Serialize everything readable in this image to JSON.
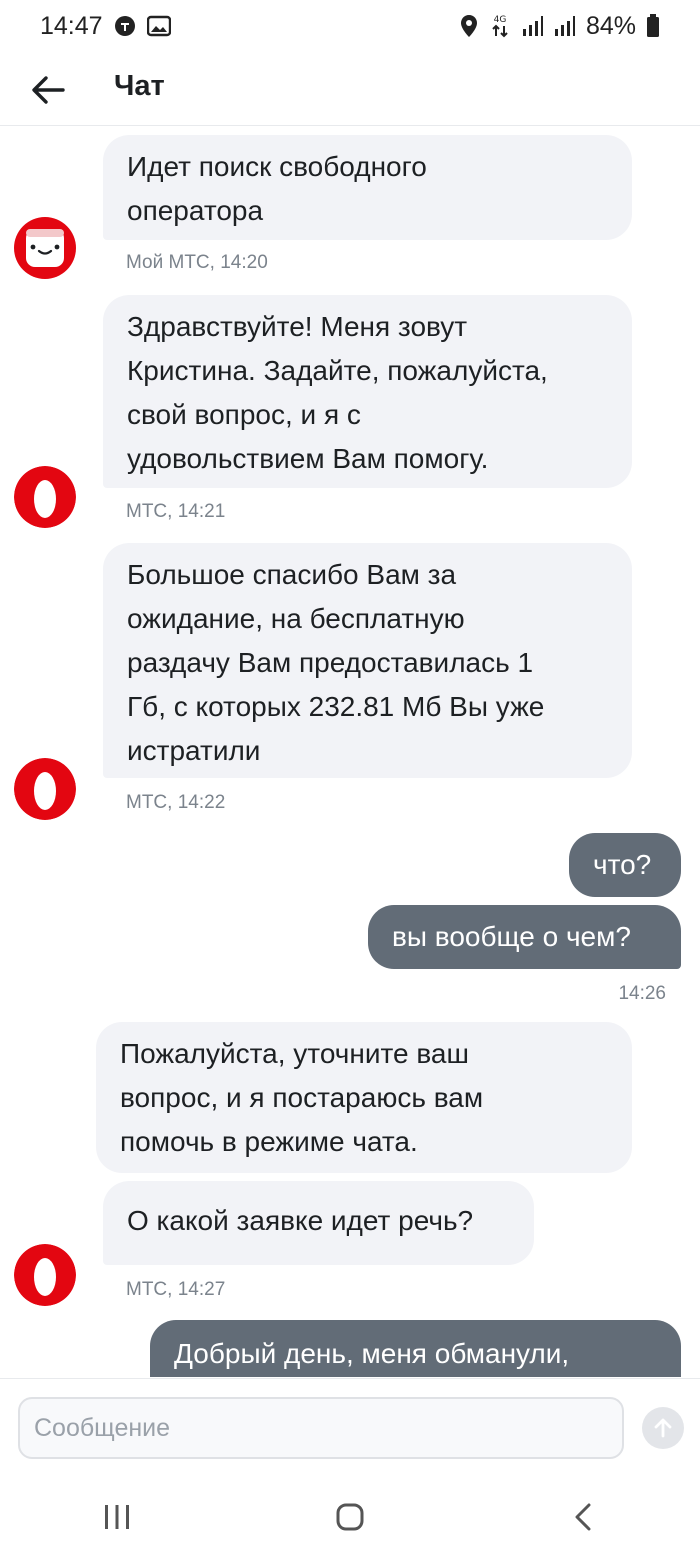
{
  "status_bar": {
    "time": "14:47",
    "network": "4G",
    "battery": "84%"
  },
  "app_bar": {
    "title": "Чат"
  },
  "messages": [
    {
      "id": "m1",
      "direction": "in",
      "text": "Идет поиск свободного\nоператора",
      "meta": "Мой МТС, 14:20",
      "avatar": "my-mts-bot"
    },
    {
      "id": "m2",
      "direction": "in",
      "text": "Здравствуйте! Меня зовут\nКристина. Задайте, пожалуйста,\nсвой вопрос, и я с\nудовольствием Вам помогу.",
      "meta": "МТС, 14:21",
      "avatar": "mts-egg"
    },
    {
      "id": "m3",
      "direction": "in",
      "text": "Большое спасибо Вам за\nожидание, на бесплатную\nраздачу Вам предоставилась 1\nГб, с которых 232.81 Мб Вы уже\nистратили",
      "meta": "МТС, 14:22",
      "avatar": "mts-egg"
    },
    {
      "id": "m4",
      "direction": "out",
      "text": "что?"
    },
    {
      "id": "m5",
      "direction": "out",
      "text": "вы вообще о чем?",
      "meta": "14:26"
    },
    {
      "id": "m6",
      "direction": "in",
      "text": "Пожалуйста, уточните ваш\nвопрос, и я постараюсь вам\nпомочь в режиме чата."
    },
    {
      "id": "m7",
      "direction": "in",
      "text": "О какой заявке идет речь?",
      "meta": "МТС, 14:27",
      "avatar": "mts-egg"
    },
    {
      "id": "m8",
      "direction": "out",
      "text": "Добрый день, меня обманули,"
    }
  ],
  "composer": {
    "placeholder": "Сообщение"
  },
  "colors": {
    "incoming_bubble": "#f2f3f7",
    "outgoing_bubble": "#626c77",
    "mts_red": "#e30611",
    "meta_text": "#7b838c"
  },
  "icons": {
    "back": "arrow-left-icon",
    "send": "arrow-up-icon",
    "nav_recent": "recent-apps-icon",
    "nav_home": "home-icon",
    "nav_back": "chevron-left-icon"
  }
}
